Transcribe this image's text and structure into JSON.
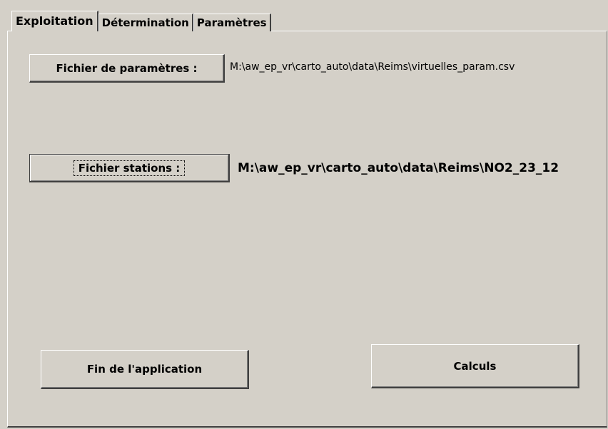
{
  "tabs": [
    {
      "label": "Exploitation",
      "active": true
    },
    {
      "label": "Détermination",
      "active": false
    },
    {
      "label": "Paramètres",
      "active": false
    }
  ],
  "param_file": {
    "button_label": "Fichier de paramètres :",
    "path": "M:\\aw_ep_vr\\carto_auto\\data\\Reims\\virtuelles_param.csv"
  },
  "stations_file": {
    "button_label": "Fichier stations :",
    "path": "M:\\aw_ep_vr\\carto_auto\\data\\Reims\\NO2_23_12"
  },
  "actions": {
    "quit_label": "Fin de l'application",
    "compute_label": "Calculs"
  },
  "colors": {
    "face": "#d4d0c8",
    "highlight": "#ffffff",
    "shadow": "#808080",
    "dark_shadow": "#404040"
  }
}
